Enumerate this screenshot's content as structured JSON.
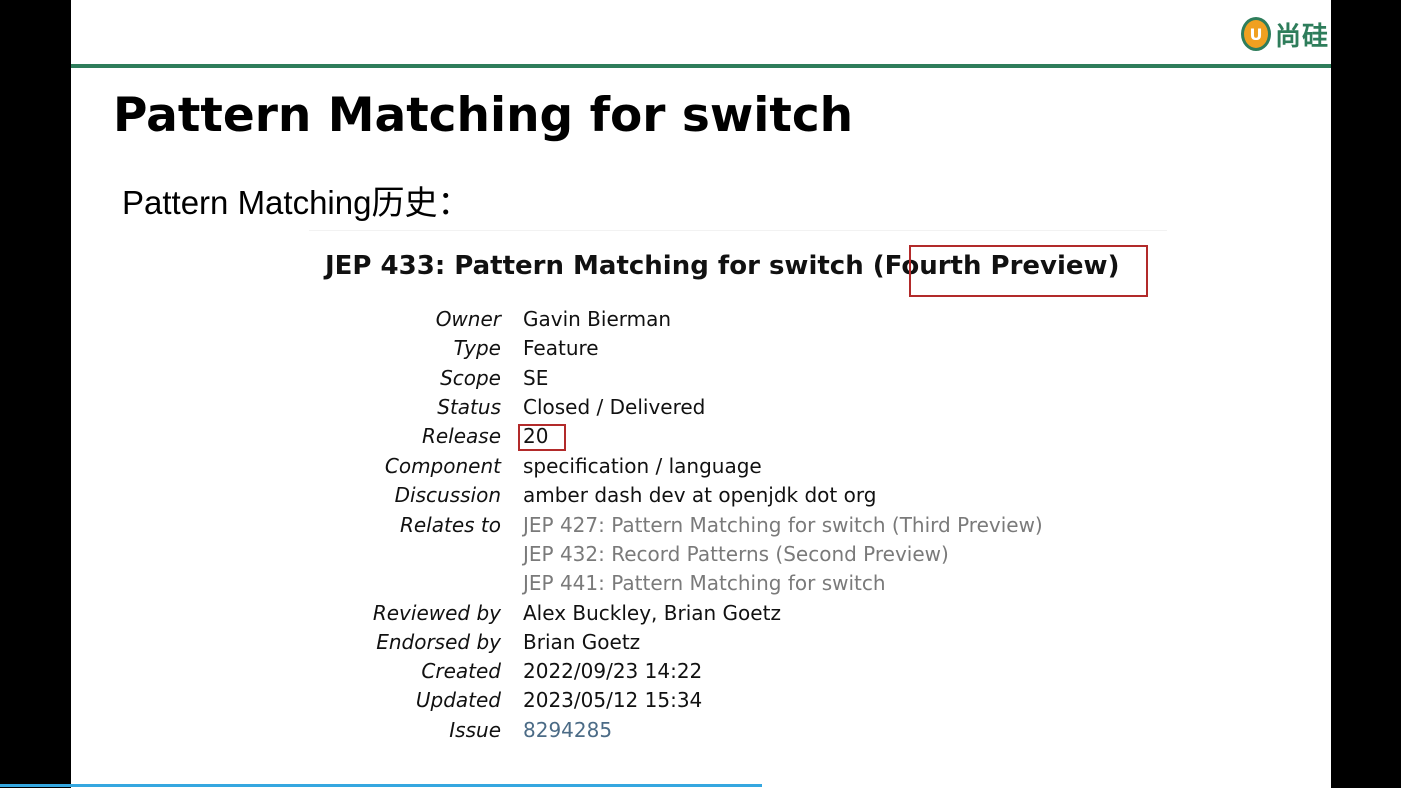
{
  "logo": {
    "mark": "U",
    "text": "尚硅"
  },
  "slide": {
    "title": "Pattern Matching for switch",
    "subtitle": "Pattern Matching历史："
  },
  "jep": {
    "title_prefix": "JEP 433: Pattern Matching for switch (",
    "title_highlight": "Fourth Preview",
    "title_suffix": ")",
    "fields": {
      "owner": {
        "label": "Owner",
        "value": "Gavin Bierman"
      },
      "type": {
        "label": "Type",
        "value": "Feature"
      },
      "scope": {
        "label": "Scope",
        "value": "SE"
      },
      "status": {
        "label": "Status",
        "value": "Closed / Delivered"
      },
      "release": {
        "label": "Release",
        "value": "20"
      },
      "component": {
        "label": "Component",
        "value": "specification / language"
      },
      "discussion": {
        "label": "Discussion",
        "value": "amber dash dev at openjdk dot org"
      },
      "relates_to": {
        "label": "Relates to",
        "items": [
          "JEP 427: Pattern Matching for switch (Third Preview)",
          "JEP 432: Record Patterns (Second Preview)",
          "JEP 441: Pattern Matching for switch"
        ]
      },
      "reviewed_by": {
        "label": "Reviewed by",
        "value": "Alex Buckley, Brian Goetz"
      },
      "endorsed_by": {
        "label": "Endorsed by",
        "value": "Brian Goetz"
      },
      "created": {
        "label": "Created",
        "value": "2022/09/23 14:22"
      },
      "updated": {
        "label": "Updated",
        "value": "2023/05/12 15:34"
      },
      "issue": {
        "label": "Issue",
        "value": "8294285"
      }
    }
  },
  "colors": {
    "brand_green": "#2e7d5b",
    "highlight_red": "#b22a2a",
    "link_gray": "#7a7a7a",
    "link_blue": "#4b6b86",
    "progress_blue": "#35a7e0"
  }
}
